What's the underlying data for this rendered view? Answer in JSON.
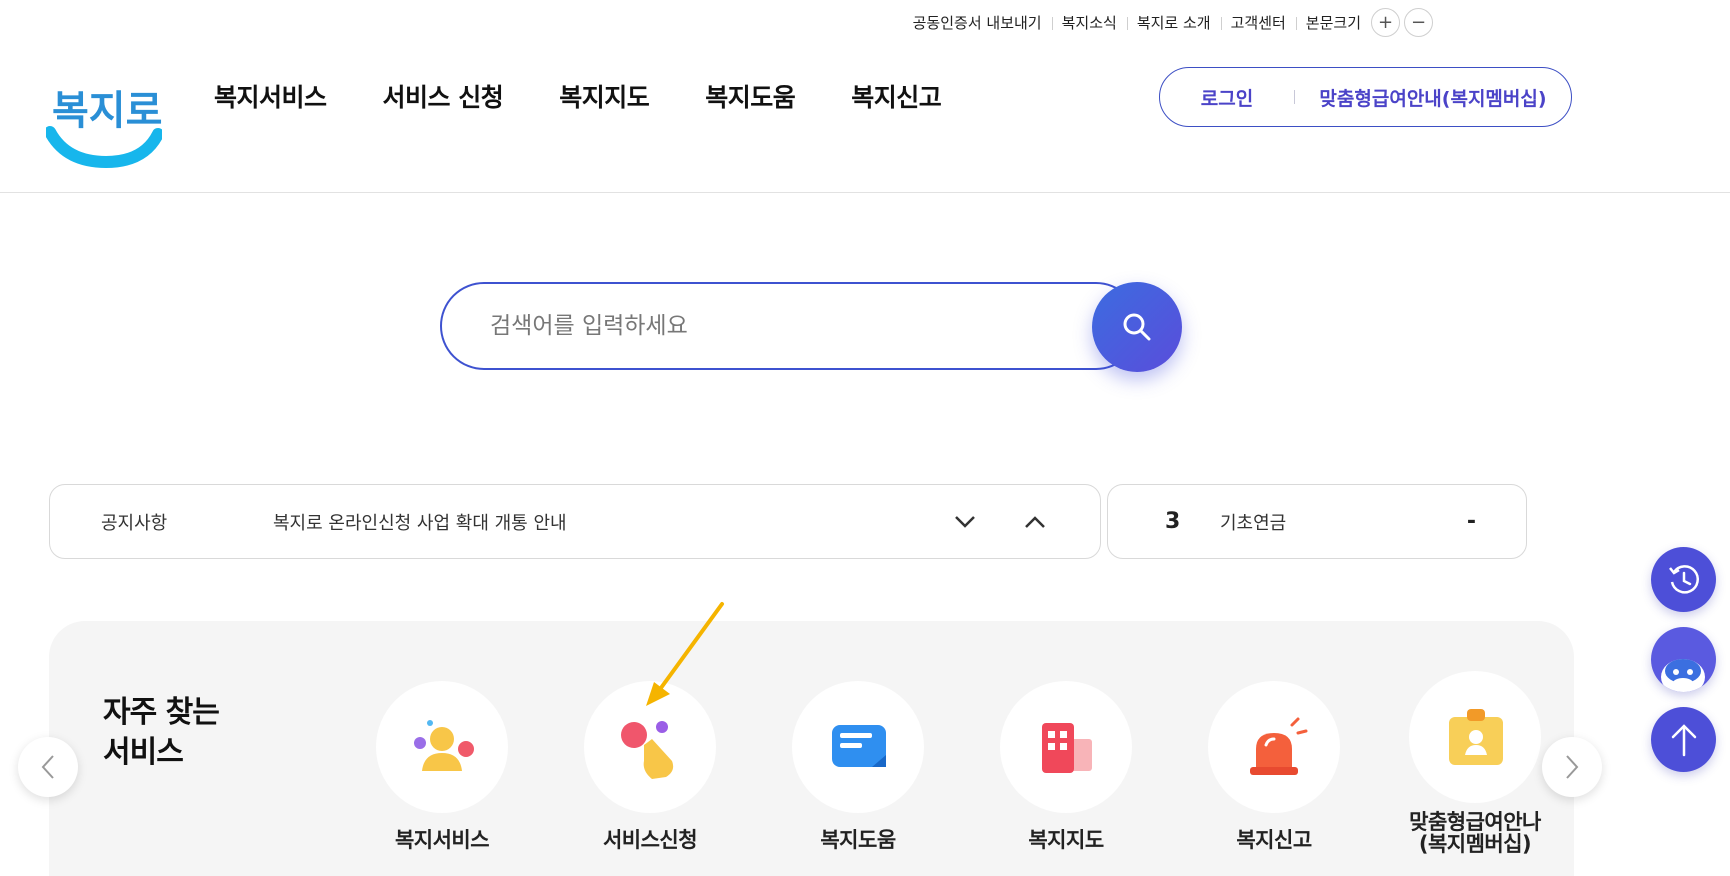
{
  "utility": {
    "links": [
      "공동인증서 내보내기",
      "복지소식",
      "복지로 소개",
      "고객센터"
    ],
    "font_size_label": "본문크기",
    "font_increase": "+",
    "font_decrease": "−"
  },
  "header": {
    "logo_text": "복지로",
    "nav": [
      "복지서비스",
      "서비스 신청",
      "복지지도",
      "복지도움",
      "복지신고"
    ],
    "login_label": "로그인",
    "membership_label": "맞춤형급여안내(복지멤버십)"
  },
  "search": {
    "placeholder": "검색어를 입력하세요",
    "value": ""
  },
  "notice": {
    "label": "공지사항",
    "text": "복지로 온라인신청 사업 확대 개통 안내"
  },
  "ranking": {
    "rank": "3",
    "keyword": "기초연금",
    "change": "-"
  },
  "frequent": {
    "title_line1": "자주 찾는",
    "title_line2": "서비스",
    "items": [
      {
        "label": "복지서비스",
        "icon": "person-icon"
      },
      {
        "label": "서비스신청",
        "icon": "hand-tap-icon"
      },
      {
        "label": "복지도움",
        "icon": "chat-card-icon"
      },
      {
        "label": "복지지도",
        "icon": "building-icon"
      },
      {
        "label": "복지신고",
        "icon": "siren-icon"
      },
      {
        "label_line1": "맞춤형급여안나",
        "label_line2": "(복지멤버십)",
        "icon": "id-badge-icon"
      }
    ]
  },
  "colors": {
    "brand": "#3e52d0",
    "accent_purple": "#4b43c8",
    "annotation_arrow": "#f5b400"
  }
}
